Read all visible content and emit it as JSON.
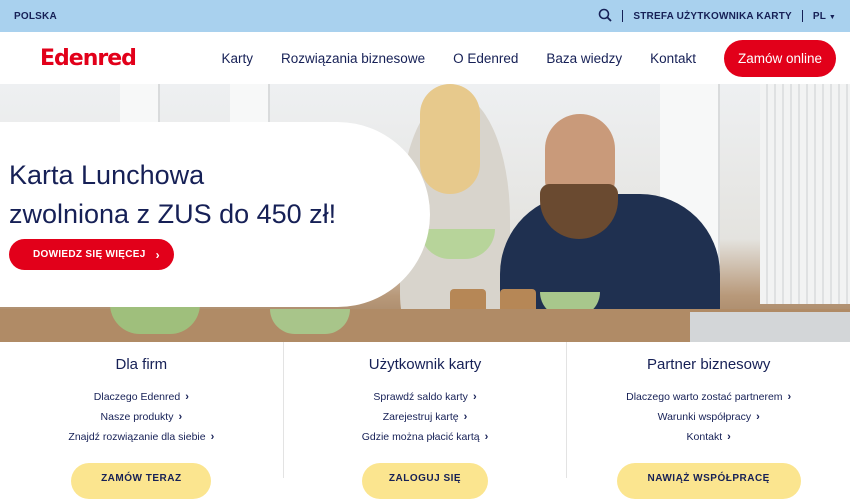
{
  "topbar": {
    "country": "POLSKA",
    "user_zone": "STREFA UŻYTKOWNIKA KARTY",
    "lang": "PL"
  },
  "nav": {
    "logo": "Edenred",
    "items": [
      "Karty",
      "Rozwiązania biznesowe",
      "O Edenred",
      "Baza wiedzy",
      "Kontakt"
    ],
    "cta": "Zamów online"
  },
  "hero": {
    "title_line1": "Karta Lunchowa",
    "title_line2": "zwolniona z ZUS do 450 zł!",
    "button": "DOWIEDZ SIĘ WIĘCEJ"
  },
  "columns": [
    {
      "title": "Dla firm",
      "links": [
        "Dlaczego Edenred",
        "Nasze produkty",
        "Znajdź rozwiązanie dla siebie"
      ],
      "button": "ZAMÓW TERAZ"
    },
    {
      "title": "Użytkownik karty",
      "links": [
        "Sprawdź saldo karty",
        "Zarejestruj kartę",
        "Gdzie można płacić kartą"
      ],
      "button": "ZALOGUJ SIĘ"
    },
    {
      "title": "Partner biznesowy",
      "links": [
        "Dlaczego warto zostać partnerem",
        "Warunki współpracy",
        "Kontakt"
      ],
      "button": "NAWIĄŻ WSPÓŁPRACĘ"
    }
  ],
  "colors": {
    "brand_red": "#e2001a",
    "navy": "#162056",
    "topbar": "#a9d1ee",
    "yellow": "#fbe58f"
  }
}
